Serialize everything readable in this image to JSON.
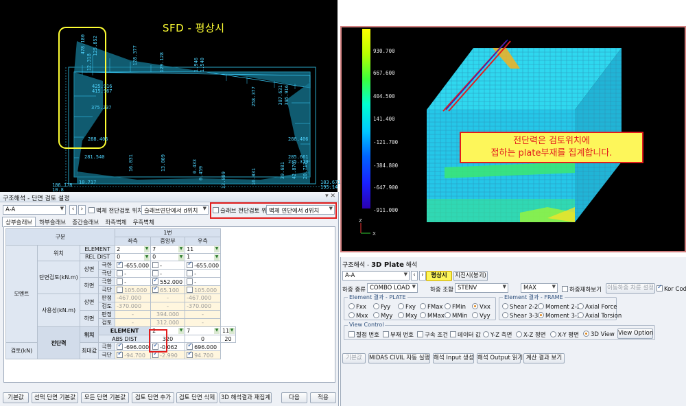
{
  "sfd": {
    "title": "SFD - 평상시",
    "labels_top": [
      "478.180",
      "125.852",
      "12.318",
      "128.377",
      "129.128",
      "1.946",
      "1.540"
    ],
    "labels_mid": [
      "425.916",
      "415.967",
      "375.237",
      "258.377",
      "387.631",
      "395.916"
    ],
    "labels_low": [
      "288.406",
      "288.406",
      "281.540",
      "235.313",
      "285.661",
      "183.671",
      "195.14"
    ],
    "labels_bottom": [
      "10.717",
      "16.031",
      "13.009",
      "0.433",
      "0.459",
      "13.009",
      "39.681",
      "42.876",
      "16.031",
      "20.717",
      "186.178",
      "10.8"
    ]
  },
  "panel": {
    "title": "구조해석 - 단면 검토 설정",
    "section": "A-A",
    "wall_check_label": "벽체 전단검토 위치",
    "wall_check_value": "슬래브연단에서 d위치",
    "slab_check_label": "슬래브 전단검토 위치",
    "slab_check_value": "벽체 연단에서 d위치",
    "tabs": [
      "상부슬래브",
      "하부슬래브",
      "중간슬래브",
      "좌측벽체",
      "우측벽체"
    ],
    "span_header": "1번",
    "col_category": "구분",
    "col_left": "좌측",
    "col_mid": "중앙부",
    "col_right": "우측",
    "moment": "모멘트",
    "shear": "전단력",
    "position": "위치",
    "element": "ELEMENT",
    "rel_dist": "REL DIST",
    "abs_dist": "ABS DIST",
    "section_check": "단면검토(kN.m)",
    "service": "사용성(kN.m)",
    "shear_check": "검토(kN)",
    "top_face": "상면",
    "bottom_face": "하면",
    "max_label": "최대값",
    "limit": "극한",
    "ultimate": "극단",
    "judge": "판정",
    "review": "검토",
    "rows": {
      "el_vals": [
        "2",
        "7",
        "11"
      ],
      "rel_vals": [
        "0",
        "0",
        "1"
      ],
      "top_lim": [
        "-655.000",
        "-",
        "-655.000"
      ],
      "top_ult": [
        "-",
        "-",
        "-"
      ],
      "bot_lim": [
        "-",
        "552.000",
        "-"
      ],
      "bot_ult": [
        "105.000",
        "65.100",
        "105.000"
      ],
      "svc_top_j": [
        "-467.000",
        "-",
        "-467.000"
      ],
      "svc_top_r": [
        "-370.000",
        "-",
        "-370.000"
      ],
      "svc_bot_j": [
        "-",
        "394.000",
        "-"
      ],
      "svc_bot_r": [
        "-",
        "312.000",
        "-"
      ],
      "sh_el": [
        "2",
        "7",
        "11"
      ],
      "sh_abs": [
        "320",
        "0",
        "20"
      ],
      "sh_lim": [
        "-696.000",
        "-0.062",
        "696.000"
      ],
      "sh_ult": [
        "-94.700",
        "-2.990",
        "94.700"
      ]
    },
    "buttons": [
      "기본값",
      "선택 단면 기본값",
      "모든 단면 기본값",
      "검토 단면 추가",
      "검토 단면 삭제",
      "3D 해석결과 재집계",
      "다음",
      "적용"
    ]
  },
  "view3d": {
    "legend": [
      "930.700",
      "667.600",
      "404.500",
      "141.400",
      "-121.700",
      "-384.800",
      "-647.900",
      "-911.000"
    ],
    "callout_line1": "전단력은 검토위치에",
    "callout_line2": "접하는 plate부재를 집계합니다.",
    "axis_z": "Z",
    "axis_x": "X"
  },
  "plate": {
    "title_prefix": "구조해석 - ",
    "title_bold": "3D Plate",
    "title_suffix": " 해석",
    "section": "A-A",
    "state_normal": "평상시",
    "state_quake": "지진시(붕괴)",
    "load_type_label": "하중 종류",
    "load_type_value": "COMBO LOAD",
    "load_combo_label": "하중 조합",
    "load_combo_value": "STENV",
    "max_value": "MAX",
    "show_load": "하중재하보기",
    "move_load": "이동하중 차륜 설정",
    "kor_code": "Kor Code",
    "plate_group": "Element 결과 - PLATE",
    "plate_opts": [
      "Fxx",
      "Fyy",
      "Fxy",
      "FMax",
      "FMin",
      "Vxx",
      "Mxx",
      "Myy",
      "Mxy",
      "MMax",
      "MMin",
      "Vyy"
    ],
    "frame_group": "Element 결과 - FRAME",
    "frame_opts": [
      "Shear 2-2",
      "Moment 2-2",
      "Axial Force",
      "Shear 3-3",
      "Moment 3-3",
      "Axial Torsion"
    ],
    "view_group": "View Control",
    "view_opts": [
      "절점 번호",
      "부재 번호",
      "구속 조건",
      "데이터 값",
      "Y-Z 측면",
      "X-Z 정면",
      "X-Y 평면",
      "3D View"
    ],
    "view_option_btn": "View Option",
    "bottom_buttons": [
      "기본값",
      "MIDAS CIVIL 자동 실행",
      "해석 Input 생성",
      "해석 Output 읽기",
      "계산 결과 보기"
    ]
  }
}
